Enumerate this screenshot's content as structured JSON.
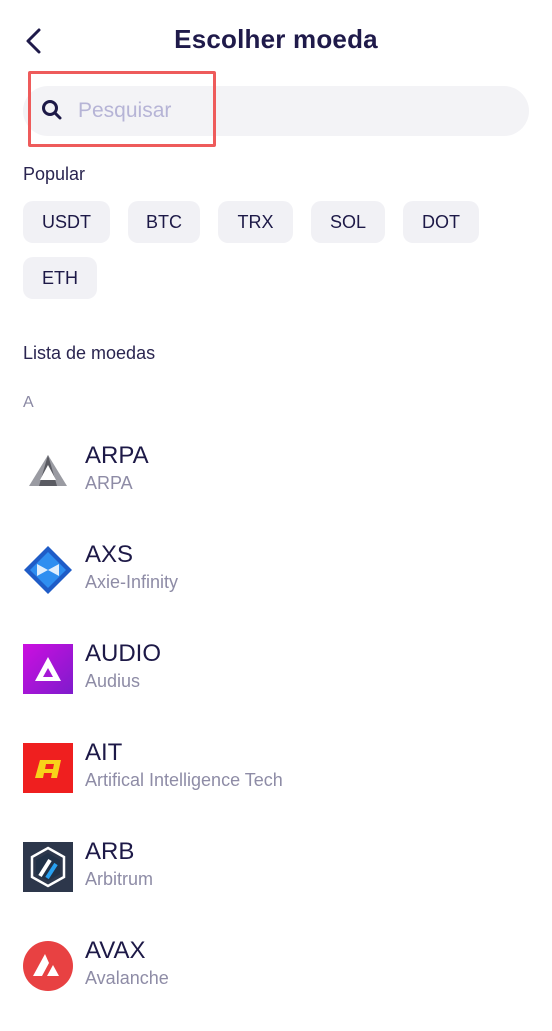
{
  "header": {
    "title": "Escolher moeda",
    "back_icon": "chevron-left-icon"
  },
  "search": {
    "placeholder": "Pesquisar",
    "value": "",
    "icon": "search-icon"
  },
  "popular": {
    "label": "Popular",
    "chips": [
      "USDT",
      "BTC",
      "TRX",
      "SOL",
      "DOT",
      "ETH"
    ]
  },
  "coin_list": {
    "label": "Lista de moedas",
    "group_letter": "A",
    "items": [
      {
        "symbol": "ARPA",
        "name": "ARPA",
        "icon": "arpa-logo-icon"
      },
      {
        "symbol": "AXS",
        "name": "Axie-Infinity",
        "icon": "axs-logo-icon"
      },
      {
        "symbol": "AUDIO",
        "name": "Audius",
        "icon": "audius-logo-icon"
      },
      {
        "symbol": "AIT",
        "name": "Artifical Intelligence Tech",
        "icon": "ait-logo-icon"
      },
      {
        "symbol": "ARB",
        "name": "Arbitrum",
        "icon": "arbitrum-logo-icon"
      },
      {
        "symbol": "AVAX",
        "name": "Avalanche",
        "icon": "avalanche-logo-icon"
      }
    ]
  },
  "colors": {
    "text": "#1d1947",
    "highlight": "#ee5b5b",
    "chip_bg": "#f1f1f5",
    "placeholder": "#b6b4d6"
  }
}
